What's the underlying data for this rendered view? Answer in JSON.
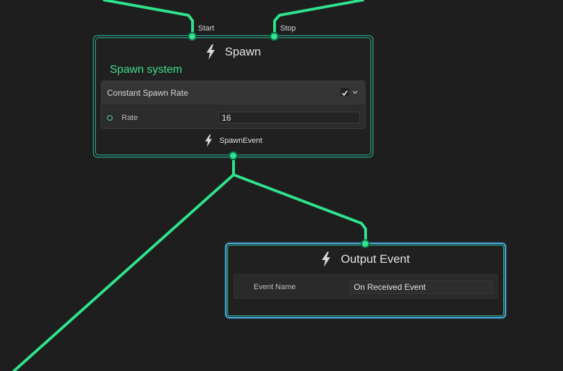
{
  "spawn_node": {
    "title": "Spawn",
    "title_icon": "lightning-bolt-icon",
    "input_ports": [
      {
        "label": "Start"
      },
      {
        "label": "Stop"
      }
    ],
    "system_name": "Spawn system",
    "block": {
      "title": "Constant Spawn Rate",
      "enabled": true,
      "checkbox_icon": "checkmark-icon",
      "expand_icon": "chevron-down-icon",
      "fields": [
        {
          "label": "Rate",
          "value": "16"
        }
      ]
    },
    "output_port": {
      "label": "SpawnEvent",
      "icon": "lightning-bolt-icon"
    }
  },
  "output_node": {
    "title": "Output Event",
    "title_icon": "lightning-bolt-icon",
    "fields": [
      {
        "label": "Event Name",
        "value": "On Received Event"
      }
    ]
  },
  "colors": {
    "background": "#1e1e1e",
    "edge": "#2fe38c",
    "system_name": "#3fe08a",
    "selected_outline": "#4aa9dc"
  }
}
